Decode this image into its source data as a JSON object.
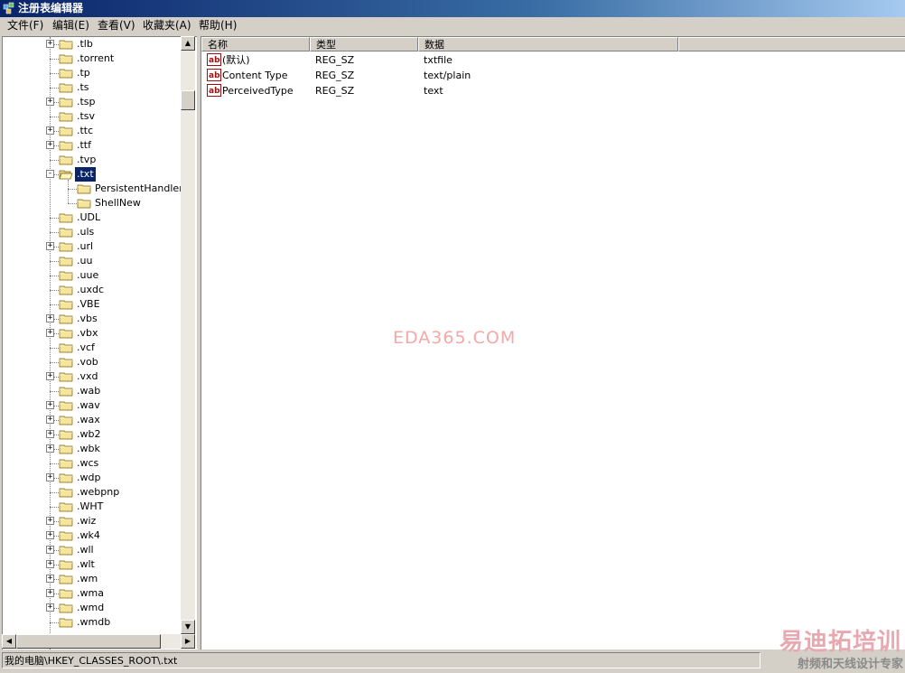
{
  "window": {
    "title": "注册表编辑器",
    "icon": "regedit-icon"
  },
  "menu": [
    "文件(F)",
    "编辑(E)",
    "查看(V)",
    "收藏夹(A)",
    "帮助(H)"
  ],
  "tree": {
    "items": [
      {
        "label": ".tlb",
        "expander": "+"
      },
      {
        "label": ".torrent",
        "expander": ""
      },
      {
        "label": ".tp",
        "expander": ""
      },
      {
        "label": ".ts",
        "expander": ""
      },
      {
        "label": ".tsp",
        "expander": "+"
      },
      {
        "label": ".tsv",
        "expander": ""
      },
      {
        "label": ".ttc",
        "expander": "+"
      },
      {
        "label": ".ttf",
        "expander": "+"
      },
      {
        "label": ".tvp",
        "expander": ""
      },
      {
        "label": ".txt",
        "expander": "−",
        "selected": true,
        "open": true
      },
      {
        "label": "PersistentHandler",
        "expander": "",
        "child": true
      },
      {
        "label": "ShellNew",
        "expander": "",
        "child": true
      },
      {
        "label": ".UDL",
        "expander": ""
      },
      {
        "label": ".uls",
        "expander": ""
      },
      {
        "label": ".url",
        "expander": "+"
      },
      {
        "label": ".uu",
        "expander": ""
      },
      {
        "label": ".uue",
        "expander": ""
      },
      {
        "label": ".uxdc",
        "expander": ""
      },
      {
        "label": ".VBE",
        "expander": ""
      },
      {
        "label": ".vbs",
        "expander": "+"
      },
      {
        "label": ".vbx",
        "expander": "+"
      },
      {
        "label": ".vcf",
        "expander": ""
      },
      {
        "label": ".vob",
        "expander": ""
      },
      {
        "label": ".vxd",
        "expander": "+"
      },
      {
        "label": ".wab",
        "expander": ""
      },
      {
        "label": ".wav",
        "expander": "+"
      },
      {
        "label": ".wax",
        "expander": "+"
      },
      {
        "label": ".wb2",
        "expander": "+"
      },
      {
        "label": ".wbk",
        "expander": "+"
      },
      {
        "label": ".wcs",
        "expander": ""
      },
      {
        "label": ".wdp",
        "expander": "+"
      },
      {
        "label": ".webpnp",
        "expander": ""
      },
      {
        "label": ".WHT",
        "expander": ""
      },
      {
        "label": ".wiz",
        "expander": "+"
      },
      {
        "label": ".wk4",
        "expander": "+"
      },
      {
        "label": ".wll",
        "expander": "+"
      },
      {
        "label": ".wlt",
        "expander": "+"
      },
      {
        "label": ".wm",
        "expander": "+"
      },
      {
        "label": ".wma",
        "expander": "+"
      },
      {
        "label": ".wmd",
        "expander": "+"
      },
      {
        "label": ".wmdb",
        "expander": ""
      }
    ]
  },
  "list": {
    "columns": [
      "名称",
      "类型",
      "数据"
    ],
    "rows": [
      {
        "name": "(默认)",
        "type": "REG_SZ",
        "data": "txtfile",
        "icon": "string-value-icon"
      },
      {
        "name": "Content Type",
        "type": "REG_SZ",
        "data": "text/plain",
        "icon": "string-value-icon"
      },
      {
        "name": "PerceivedType",
        "type": "REG_SZ",
        "data": "text",
        "icon": "string-value-icon"
      }
    ]
  },
  "watermark": "EDA365.COM",
  "status": "我的电脑\\HKEY_CLASSES_ROOT\\.txt",
  "logo": {
    "main": "易迪拓培训",
    "sub": "射频和天线设计专家"
  },
  "colors": {
    "title_bar": "#0a246a",
    "selection": "#0a246a",
    "chrome": "#d4d0c8",
    "watermark": "#f4a8a8"
  }
}
